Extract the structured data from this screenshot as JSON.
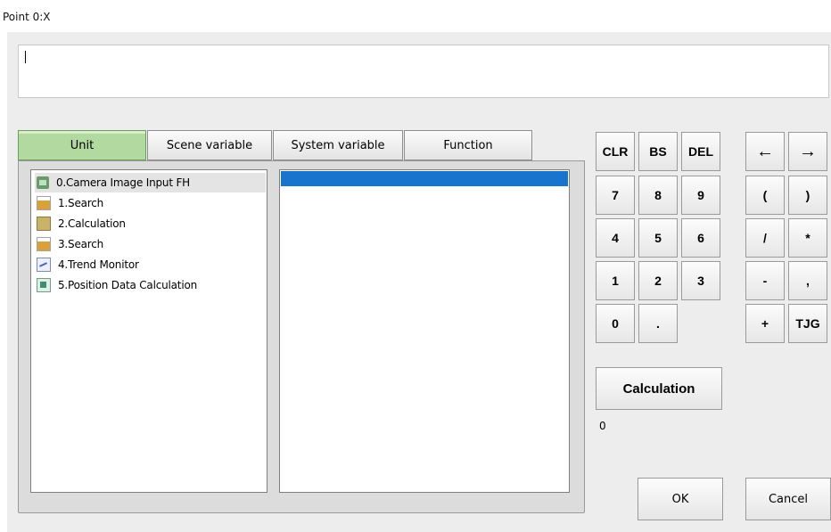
{
  "window": {
    "title": "Point 0:X"
  },
  "expression": {
    "value": ""
  },
  "tabs": [
    "Unit",
    "Scene variable",
    "System variable",
    "Function"
  ],
  "active_tab": "Unit",
  "units": [
    {
      "label": "0.Camera Image Input FH",
      "icon": "camera-icon"
    },
    {
      "label": "1.Search",
      "icon": "search-icon"
    },
    {
      "label": "2.Calculation",
      "icon": "calculation-icon"
    },
    {
      "label": "3.Search",
      "icon": "search-icon"
    },
    {
      "label": "4.Trend Monitor",
      "icon": "trend-monitor-icon"
    },
    {
      "label": "5.Position Data Calculation",
      "icon": "position-data-icon"
    }
  ],
  "keypad": {
    "edit": [
      "CLR",
      "BS",
      "DEL"
    ],
    "row1": [
      "7",
      "8",
      "9"
    ],
    "row2": [
      "4",
      "5",
      "6"
    ],
    "row3": [
      "1",
      "2",
      "3"
    ],
    "row4": [
      "0",
      "."
    ],
    "arrows": [
      "←",
      "→"
    ],
    "ops": [
      [
        "(",
        ")"
      ],
      [
        "/",
        "*"
      ],
      [
        "-",
        ","
      ],
      [
        "+",
        "TJG"
      ]
    ]
  },
  "calculation_label": "Calculation",
  "result_value": "0",
  "ok_label": "OK",
  "cancel_label": "Cancel",
  "colors": {
    "active_tab": "#b2d9a0",
    "selection": "#1874cd"
  }
}
